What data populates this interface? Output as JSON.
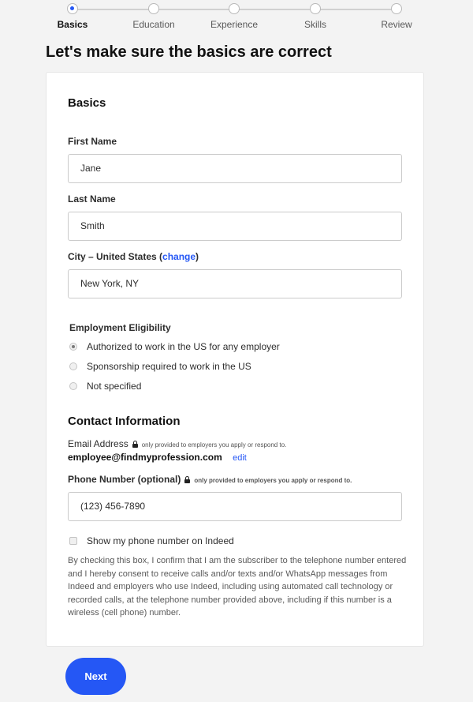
{
  "stepper": {
    "steps": [
      {
        "label": "Basics",
        "active": true
      },
      {
        "label": "Education",
        "active": false
      },
      {
        "label": "Experience",
        "active": false
      },
      {
        "label": "Skills",
        "active": false
      },
      {
        "label": "Review",
        "active": false
      }
    ]
  },
  "page_title": "Let's make sure the basics are correct",
  "basics": {
    "section_title": "Basics",
    "first_name": {
      "label": "First Name",
      "value": "Jane"
    },
    "last_name": {
      "label": "Last Name",
      "value": "Smith"
    },
    "city": {
      "label_prefix": "City – United States (",
      "change_link": "change",
      "label_suffix": ")",
      "value": "New York, NY"
    }
  },
  "eligibility": {
    "label": "Employment Eligibility",
    "options": [
      {
        "label": "Authorized to work in the US for any employer",
        "checked": true
      },
      {
        "label": "Sponsorship required to work in the US",
        "checked": false
      },
      {
        "label": "Not specified",
        "checked": false
      }
    ]
  },
  "contact": {
    "section_title": "Contact Information",
    "email_label": "Email Address",
    "email_note": "only provided to employers you apply or respond to.",
    "email_value": "employee@findmyprofession.com",
    "edit_link": "edit",
    "phone_label": "Phone Number (optional)",
    "phone_note": "only provided to employers you apply or respond to.",
    "phone_value": "(123) 456-7890",
    "show_phone_label": "Show my phone number on Indeed",
    "show_phone_checked": false,
    "disclaimer": "By checking this box, I confirm that I am the subscriber to the telephone number entered and I hereby consent to receive calls and/or texts and/or WhatsApp messages from Indeed and employers who use Indeed, including using automated call technology or recorded calls, at the telephone number provided above, including if this number is a wireless (cell phone) number."
  },
  "next_button": "Next",
  "colors": {
    "accent": "#2557f5",
    "background": "#f3f3f3"
  }
}
